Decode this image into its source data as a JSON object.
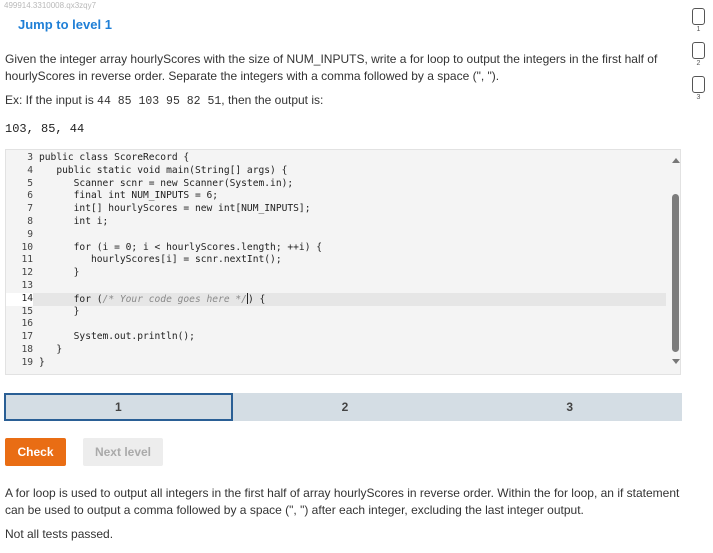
{
  "activity_id": "499914.3310008.qx3zqy7",
  "jump_link": "Jump to level 1",
  "prompt": {
    "p1": "Given the integer array hourlyScores with the size of NUM_INPUTS, write a for loop to output the integers in the first half of hourlyScores in reverse order. Separate the integers with a comma followed by a space (\", \").",
    "ex_prefix": "Ex: If the input is ",
    "ex_input": "44 85 103 95 82 51",
    "ex_suffix": ", then the output is:",
    "output": "103, 85, 44"
  },
  "levels": [
    "1",
    "2",
    "3"
  ],
  "editor": {
    "lines": [
      {
        "n": "3",
        "text": "public class ScoreRecord {"
      },
      {
        "n": "4",
        "text": "   public static void main(String[] args) {"
      },
      {
        "n": "5",
        "text": "      Scanner scnr = new Scanner(System.in);"
      },
      {
        "n": "6",
        "text": "      final int NUM_INPUTS = 6;"
      },
      {
        "n": "7",
        "text": "      int[] hourlyScores = new int[NUM_INPUTS];"
      },
      {
        "n": "8",
        "text": "      int i;"
      },
      {
        "n": "9",
        "text": ""
      },
      {
        "n": "10",
        "text": "      for (i = 0; i < hourlyScores.length; ++i) {"
      },
      {
        "n": "11",
        "text": "         hourlyScores[i] = scnr.nextInt();"
      },
      {
        "n": "12",
        "text": "      }"
      },
      {
        "n": "13",
        "text": ""
      },
      {
        "n": "14",
        "text_before": "      for (",
        "comment": "/* Your code goes here */",
        "text_after": ") {"
      },
      {
        "n": "15",
        "text": "      }"
      },
      {
        "n": "16",
        "text": ""
      },
      {
        "n": "17",
        "text": "      System.out.println();"
      },
      {
        "n": "18",
        "text": "   }"
      },
      {
        "n": "19",
        "text": "}"
      }
    ]
  },
  "tabs": [
    "1",
    "2",
    "3"
  ],
  "active_tab": "1",
  "buttons": {
    "check": "Check",
    "next": "Next level"
  },
  "hint": "A for loop is used to output all integers in the first half of array hourlyScores in reverse order. Within the for loop, an if statement can be used to output a comma followed by a space (\", \") after each integer, excluding the last integer output.",
  "status": "Not all tests passed.",
  "colors": {
    "accent_link": "#1f7fd6",
    "check_button": "#e96d14",
    "tab_bar": "#d4dde4",
    "active_tab_border": "#2a5f95"
  }
}
